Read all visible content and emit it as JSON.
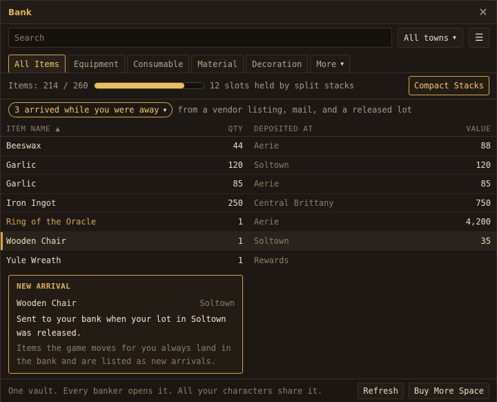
{
  "window": {
    "title": "Bank"
  },
  "search": {
    "placeholder": "Search",
    "value": ""
  },
  "town_filter": {
    "selected": "All towns"
  },
  "tabs": [
    {
      "label": "All Items",
      "active": true
    },
    {
      "label": "Equipment"
    },
    {
      "label": "Consumable"
    },
    {
      "label": "Material"
    },
    {
      "label": "Decoration"
    },
    {
      "label": "More",
      "has_dropdown": true
    }
  ],
  "summary": {
    "items_text": "Items: 214 / 260",
    "used": 214,
    "capacity": 260,
    "split_text": "12 slots held by split stacks",
    "compact_label": "Compact Stacks"
  },
  "arrivals": {
    "pill_label": "3 arrived while you were away",
    "note": "from a vendor listing, mail, and a released lot"
  },
  "table": {
    "headers": {
      "name": "ITEM NAME ▲",
      "qty": "QTY",
      "deposited": "DEPOSITED AT",
      "value": "VALUE"
    },
    "rows": [
      {
        "name": "Beeswax",
        "qty": "44",
        "deposited": "Aerie",
        "value": "88"
      },
      {
        "name": "Garlic",
        "qty": "120",
        "deposited": "Soltown",
        "value": "120"
      },
      {
        "name": "Garlic",
        "qty": "85",
        "deposited": "Aerie",
        "value": "85"
      },
      {
        "name": "Iron Ingot",
        "qty": "250",
        "deposited": "Central Brittany",
        "value": "750"
      },
      {
        "name": "Ring of the Oracle",
        "qty": "1",
        "deposited": "Aerie",
        "value": "4,200",
        "highlight": true
      },
      {
        "name": "Wooden Chair",
        "qty": "1",
        "deposited": "Soltown",
        "value": "35",
        "selected": true
      },
      {
        "name": "Yule Wreath",
        "qty": "1",
        "deposited": "Rewards",
        "value": ""
      }
    ]
  },
  "tooltip": {
    "heading": "NEW ARRIVAL",
    "item": "Wooden Chair",
    "town": "Soltown",
    "description": "Sent to your bank when your lot in Soltown was released.",
    "footnote": "Items the game moves for you always land in the bank and are listed as new arrivals."
  },
  "footer": {
    "text": "One vault. Every banker opens it. All your characters share it.",
    "refresh_label": "Refresh",
    "buy_label": "Buy More Space"
  },
  "colors": {
    "accent": "#d9a843",
    "background": "#1d1813"
  }
}
